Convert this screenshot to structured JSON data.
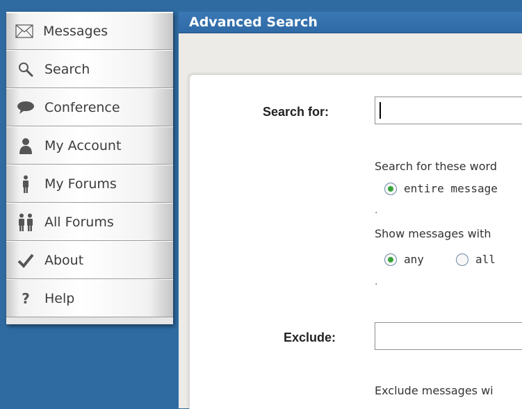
{
  "sidebar": {
    "items": [
      {
        "label": "Messages",
        "icon": "envelope-icon"
      },
      {
        "label": "Search",
        "icon": "search-icon"
      },
      {
        "label": "Conference",
        "icon": "speech-bubble-icon"
      },
      {
        "label": "My Account",
        "icon": "user-icon"
      },
      {
        "label": "My Forums",
        "icon": "person-icon"
      },
      {
        "label": "All Forums",
        "icon": "people-icon"
      },
      {
        "label": "About",
        "icon": "checkmark-icon"
      },
      {
        "label": "Help",
        "icon": "question-icon"
      }
    ]
  },
  "panel": {
    "title": "Advanced Search",
    "search_for_label": "Search for:",
    "search_value": "",
    "search_scope_text": "Search for these word",
    "scope_option": "entire message",
    "show_messages_text": "Show messages with",
    "match_options": [
      "any",
      "all"
    ],
    "exclude_label": "Exclude:",
    "exclude_value": "",
    "exclude_messages_text": "Exclude messages wi",
    "dot": "."
  },
  "colors": {
    "background": "#2f6ba1",
    "titlebar": "#3473b0",
    "radio_selected": "#36a33a"
  }
}
